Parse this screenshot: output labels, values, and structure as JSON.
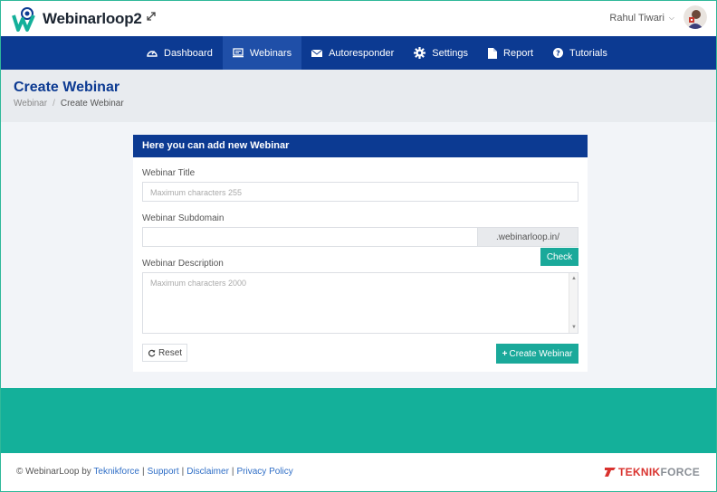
{
  "app": {
    "name": "Webinarloop2"
  },
  "user": {
    "name": "Rahul Tiwari"
  },
  "nav": {
    "items": [
      {
        "label": "Dashboard",
        "icon": "dashboard-icon"
      },
      {
        "label": "Webinars",
        "icon": "monitor-icon",
        "active": true
      },
      {
        "label": "Autoresponder",
        "icon": "envelope-icon"
      },
      {
        "label": "Settings",
        "icon": "gear-icon"
      },
      {
        "label": "Report",
        "icon": "file-icon"
      },
      {
        "label": "Tutorials",
        "icon": "question-circle-icon"
      }
    ]
  },
  "page": {
    "title": "Create Webinar",
    "breadcrumb": {
      "parent": "Webinar",
      "separator": "/",
      "current": "Create Webinar"
    }
  },
  "form": {
    "header": "Here you can add new Webinar",
    "title_label": "Webinar Title",
    "title_placeholder": "Maximum characters 255",
    "subdomain_label": "Webinar Subdomain",
    "subdomain_value": "",
    "subdomain_suffix": ".webinarloop.in/",
    "check_button": "Check",
    "description_label": "Webinar Description",
    "description_placeholder": "Maximum characters 2000",
    "reset_button": "Reset",
    "create_button": "Create Webinar"
  },
  "footer": {
    "copyright": "© WebinarLoop by",
    "company": "Teknikforce",
    "links": [
      "Support",
      "Disclaimer",
      "Privacy Policy"
    ],
    "brand_a": "TEKNIK",
    "brand_b": "FORCE"
  },
  "colors": {
    "navy": "#0c3a92",
    "teal": "#14b09a",
    "button_teal": "#1aa99a",
    "brand_red": "#d9322e"
  }
}
